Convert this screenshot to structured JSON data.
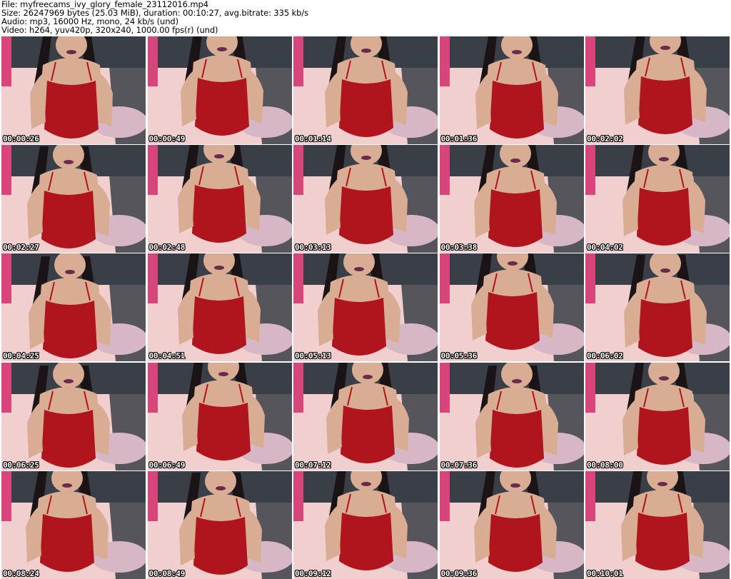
{
  "header": {
    "file_line": "File: myfreecams_ivy_glory_female_23112016.mp4",
    "size_line": "Size: 26247969 bytes (25.03 MiB), duration: 00:10:27, avg.bitrate: 335 kb/s",
    "audio_line": "Audio: mp3, 16000 Hz, mono, 24 kb/s (und)",
    "video_line": "Video: h264, yuv420p, 320x240, 1000.00 fps(r) (und)"
  },
  "thumbnails": [
    {
      "timestamp": "00:00:26"
    },
    {
      "timestamp": "00:00:49"
    },
    {
      "timestamp": "00:01:14"
    },
    {
      "timestamp": "00:01:36"
    },
    {
      "timestamp": "00:02:02"
    },
    {
      "timestamp": "00:02:27"
    },
    {
      "timestamp": "00:02:48"
    },
    {
      "timestamp": "00:03:13"
    },
    {
      "timestamp": "00:03:38"
    },
    {
      "timestamp": "00:04:02"
    },
    {
      "timestamp": "00:04:25"
    },
    {
      "timestamp": "00:04:51"
    },
    {
      "timestamp": "00:05:13"
    },
    {
      "timestamp": "00:05:36"
    },
    {
      "timestamp": "00:06:02"
    },
    {
      "timestamp": "00:06:25"
    },
    {
      "timestamp": "00:06:49"
    },
    {
      "timestamp": "00:07:12"
    },
    {
      "timestamp": "00:07:36"
    },
    {
      "timestamp": "00:08:00"
    },
    {
      "timestamp": "00:08:24"
    },
    {
      "timestamp": "00:08:49"
    },
    {
      "timestamp": "00:09:12"
    },
    {
      "timestamp": "00:09:36"
    },
    {
      "timestamp": "00:10:01"
    }
  ],
  "colors": {
    "bedsheet": "#f2cfcf",
    "wall": "#3a3f47",
    "pink_wall": "#d8457a",
    "garment": "#b0141c",
    "skin": "#d9ad94",
    "hair": "#1a1416",
    "blanket": "#d7b7c6"
  }
}
